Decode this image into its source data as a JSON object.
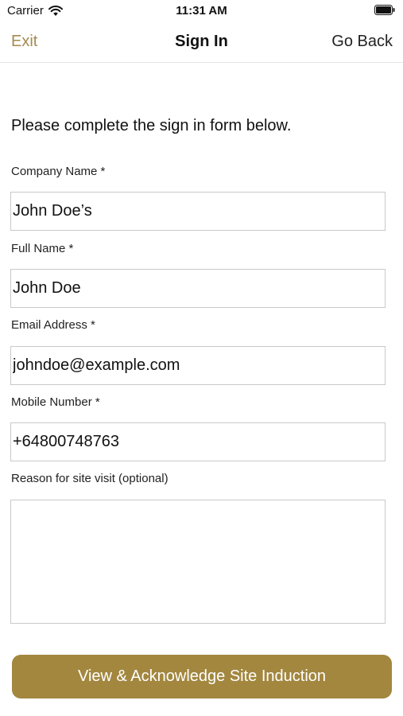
{
  "status_bar": {
    "carrier": "Carrier",
    "time": "11:31 AM",
    "wifi_icon": "wifi-icon",
    "battery_icon": "battery-icon"
  },
  "nav": {
    "exit_label": "Exit",
    "title": "Sign In",
    "back_label": "Go Back"
  },
  "form": {
    "intro": "Please complete the sign in form below.",
    "company": {
      "label": "Company Name *",
      "value": "John Doe’s"
    },
    "full_name": {
      "label": "Full Name *",
      "value": "John Doe"
    },
    "email": {
      "label": "Email Address *",
      "value": "johndoe@example.com"
    },
    "mobile": {
      "label": "Mobile Number *",
      "value": "+64800748763"
    },
    "reason": {
      "label": "Reason for site visit (optional)",
      "value": ""
    },
    "submit_label": "View & Acknowledge Site Induction"
  },
  "colors": {
    "accent": "#a68a4e",
    "button": "#a3873f"
  }
}
